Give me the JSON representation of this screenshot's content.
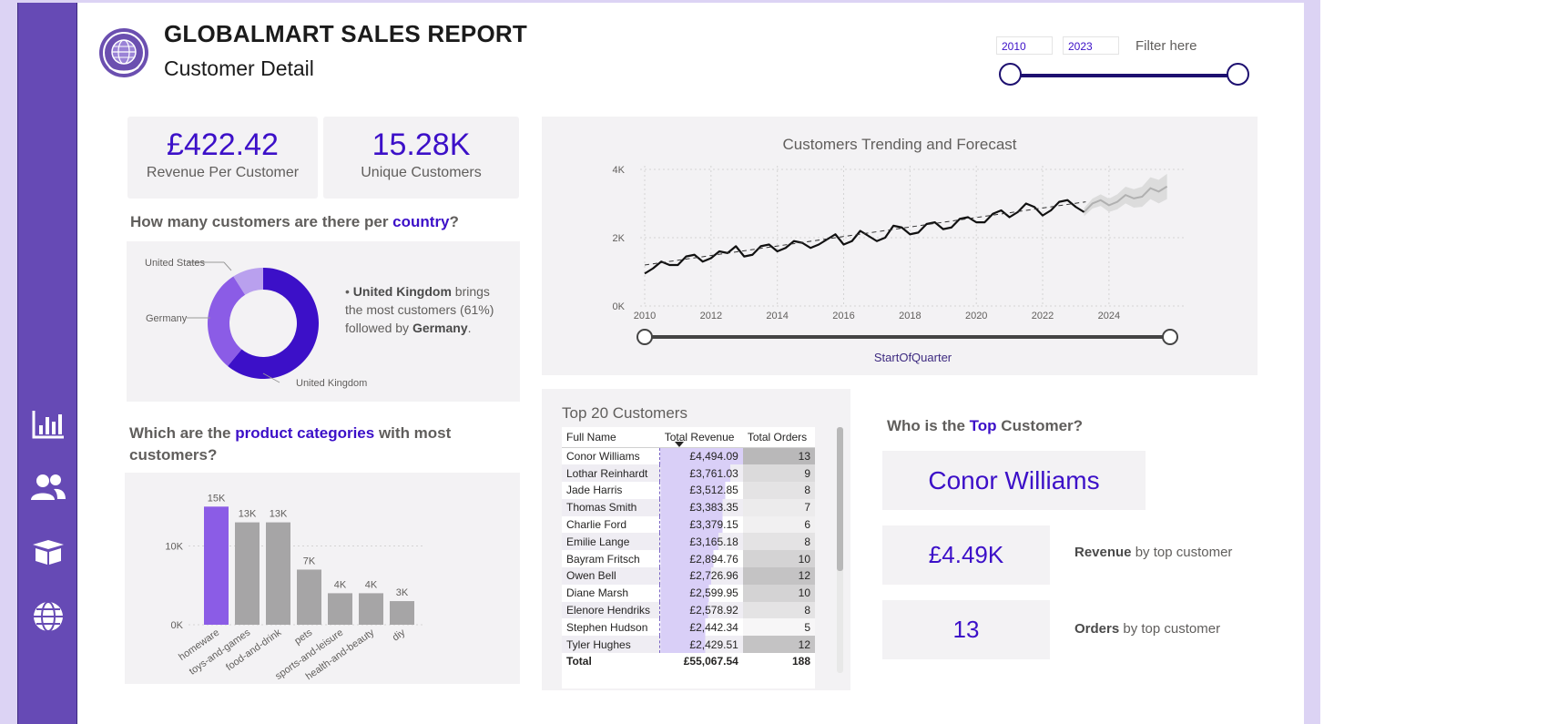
{
  "header": {
    "title": "GLOBALMART SALES REPORT",
    "subtitle": "Customer Detail"
  },
  "filter": {
    "year_from": "2010",
    "year_to": "2023",
    "label": "Filter here"
  },
  "kpis": {
    "revenue_per_customer": {
      "value": "£422.42",
      "label": "Revenue Per Customer"
    },
    "unique_customers": {
      "value": "15.28K",
      "label": "Unique Customers"
    }
  },
  "country_section": {
    "title_pre": "How many customers are there per ",
    "title_accent": "country",
    "title_post": "?",
    "bullet": "•",
    "insight_country": "United Kingdom",
    "insight_text_1": " brings the most customers (61%) followed by ",
    "insight_country_2": "Germany",
    "insight_text_2": "."
  },
  "category_section": {
    "title_pre": "Which are the ",
    "title_accent": "product categories",
    "title_post": " with most customers?"
  },
  "trend_section": {
    "title": "Customers Trending and Forecast",
    "slider_label": "StartOfQuarter"
  },
  "table": {
    "title": "Top 20 Customers",
    "headers": [
      "Full Name",
      "Total Revenue",
      "Total Orders"
    ],
    "rows": [
      {
        "name": "Conor Williams",
        "revenue": "£4,494.09",
        "orders": "13"
      },
      {
        "name": "Lothar Reinhardt",
        "revenue": "£3,761.03",
        "orders": "9"
      },
      {
        "name": "Jade Harris",
        "revenue": "£3,512.85",
        "orders": "8"
      },
      {
        "name": "Thomas Smith",
        "revenue": "£3,383.35",
        "orders": "7"
      },
      {
        "name": "Charlie Ford",
        "revenue": "£3,379.15",
        "orders": "6"
      },
      {
        "name": "Emilie Lange",
        "revenue": "£3,165.18",
        "orders": "8"
      },
      {
        "name": "Bayram Fritsch",
        "revenue": "£2,894.76",
        "orders": "10"
      },
      {
        "name": "Owen Bell",
        "revenue": "£2,726.96",
        "orders": "12"
      },
      {
        "name": "Diane Marsh",
        "revenue": "£2,599.95",
        "orders": "10"
      },
      {
        "name": "Elenore Hendriks",
        "revenue": "£2,578.92",
        "orders": "8"
      },
      {
        "name": "Stephen Hudson",
        "revenue": "£2,442.34",
        "orders": "5"
      },
      {
        "name": "Tyler Hughes",
        "revenue": "£2,429.51",
        "orders": "12"
      }
    ],
    "total": {
      "label": "Total",
      "revenue": "£55,067.54",
      "orders": "188"
    }
  },
  "top_customer": {
    "title_pre": "Who is the ",
    "title_accent": "Top",
    "title_post": " Customer?",
    "name": "Conor Williams",
    "revenue_value": "£4.49K",
    "revenue_label_bold": "Revenue",
    "revenue_label_rest": " by top customer",
    "orders_value": "13",
    "orders_label_bold": "Orders",
    "orders_label_rest": " by top customer"
  },
  "nav": {
    "icons": [
      "bar-chart-icon",
      "users-icon",
      "box-icon",
      "globe-icon"
    ]
  },
  "colors": {
    "accent": "#3c10c8",
    "sidebar": "#664ab5",
    "bar_highlight": "#8b5ce6",
    "bar_grey": "#a6a5a6",
    "panel": "#f3f2f4"
  },
  "chart_data": [
    {
      "type": "pie",
      "title": "",
      "labels": [
        "United Kingdom",
        "Germany",
        "United States"
      ],
      "values": [
        61,
        30,
        9
      ],
      "colors": [
        "#3c10c8",
        "#8b5ce6",
        "#b9a0ee"
      ]
    },
    {
      "type": "bar",
      "title": "",
      "categories": [
        "homeware",
        "toys-and-games",
        "food-and-drink",
        "pets",
        "sports-and-leisure",
        "health-and-beauty",
        "diy"
      ],
      "values": [
        15000,
        13000,
        13000,
        7000,
        4000,
        4000,
        3000
      ],
      "data_labels": [
        "15K",
        "13K",
        "13K",
        "7K",
        "4K",
        "4K",
        "3K"
      ],
      "yticks": [
        "0K",
        "10K"
      ],
      "ylim": [
        0,
        17000
      ],
      "highlight_index": 0
    },
    {
      "type": "line",
      "title": "Customers Trending and Forecast",
      "xlabel": "",
      "ylabel": "",
      "xticks": [
        "2010",
        "2012",
        "2014",
        "2016",
        "2018",
        "2020",
        "2022",
        "2024"
      ],
      "yticks": [
        "0K",
        "2K",
        "4K"
      ],
      "xlim": [
        2010,
        2026.2
      ],
      "ylim": [
        0,
        4000
      ],
      "grid": true,
      "series": [
        {
          "x": [
            2010,
            2010.25,
            2010.5,
            2010.75,
            2011,
            2011.25,
            2011.5,
            2011.75,
            2012,
            2012.25,
            2012.5,
            2012.75,
            2013,
            2013.25,
            2013.5,
            2013.75,
            2014,
            2014.25,
            2014.5,
            2014.75,
            2015,
            2015.25,
            2015.5,
            2015.75,
            2016,
            2016.25,
            2016.5,
            2016.75,
            2017,
            2017.25,
            2017.5,
            2017.75,
            2018,
            2018.25,
            2018.5,
            2018.75,
            2019,
            2019.25,
            2019.5,
            2019.75,
            2020,
            2020.25,
            2020.5,
            2020.75,
            2021,
            2021.25,
            2021.5,
            2021.75,
            2022,
            2022.25,
            2022.5,
            2022.75,
            2023,
            2023.25
          ],
          "values": [
            950,
            1100,
            1300,
            1200,
            1200,
            1450,
            1500,
            1300,
            1400,
            1600,
            1550,
            1750,
            1450,
            1500,
            1750,
            1800,
            1600,
            1700,
            1900,
            1850,
            1700,
            1800,
            1950,
            2100,
            1800,
            1900,
            2200,
            2050,
            1900,
            2000,
            2350,
            2300,
            2100,
            2150,
            2400,
            2450,
            2250,
            2300,
            2550,
            2600,
            2450,
            2450,
            2700,
            2800,
            2600,
            2750,
            3000,
            2900,
            2650,
            2800,
            3050,
            3100,
            2900,
            2750
          ]
        },
        {
          "x": [
            2023.25,
            2023.5,
            2023.75,
            2024,
            2024.25,
            2024.5,
            2024.75,
            2025,
            2025.25,
            2025.5,
            2025.75
          ],
          "values": [
            2750,
            3000,
            3100,
            2950,
            3050,
            3250,
            3150,
            3200,
            3450,
            3350,
            3500
          ]
        }
      ]
    }
  ]
}
